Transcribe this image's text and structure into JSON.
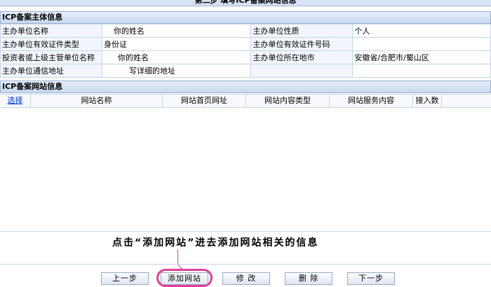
{
  "page": {
    "step_title": "第二步  填写ICP备案网站信息"
  },
  "entity_section": {
    "title": "ICP备案主体信息",
    "rows": [
      [
        {
          "label": "主办单位名称",
          "value": "你的姓名"
        },
        {
          "label": "主办单位性质",
          "value": "个人"
        }
      ],
      [
        {
          "label": "主办单位有效证件类型",
          "value": "身份证"
        },
        {
          "label": "主办单位有效证件号码",
          "value": ""
        }
      ],
      [
        {
          "label": "投资者或上级主管单位名称",
          "value": "你的姓名"
        },
        {
          "label": "主办单位所在地市",
          "value": "安徽省/合肥市/蜀山区"
        }
      ],
      [
        {
          "label": "主办单位通信地址",
          "value": "写详细的地址"
        },
        {
          "label": "",
          "value": ""
        }
      ]
    ]
  },
  "website_section": {
    "title": "ICP备案网站信息",
    "columns": [
      "选择",
      "网站名称",
      "网站首页网址",
      "网站内容类型",
      "网站服务内容",
      "接入数"
    ]
  },
  "instruction": "点击“添加网站”进去添加网站相关的信息",
  "buttons": {
    "prev": "上一步",
    "add": "添加网站",
    "edit": "修  改",
    "delete": "删  除",
    "next": "下一步"
  },
  "colors": {
    "highlight": "#e0409a",
    "header_bg": "#d6e3f5",
    "link": "#0033cc"
  }
}
